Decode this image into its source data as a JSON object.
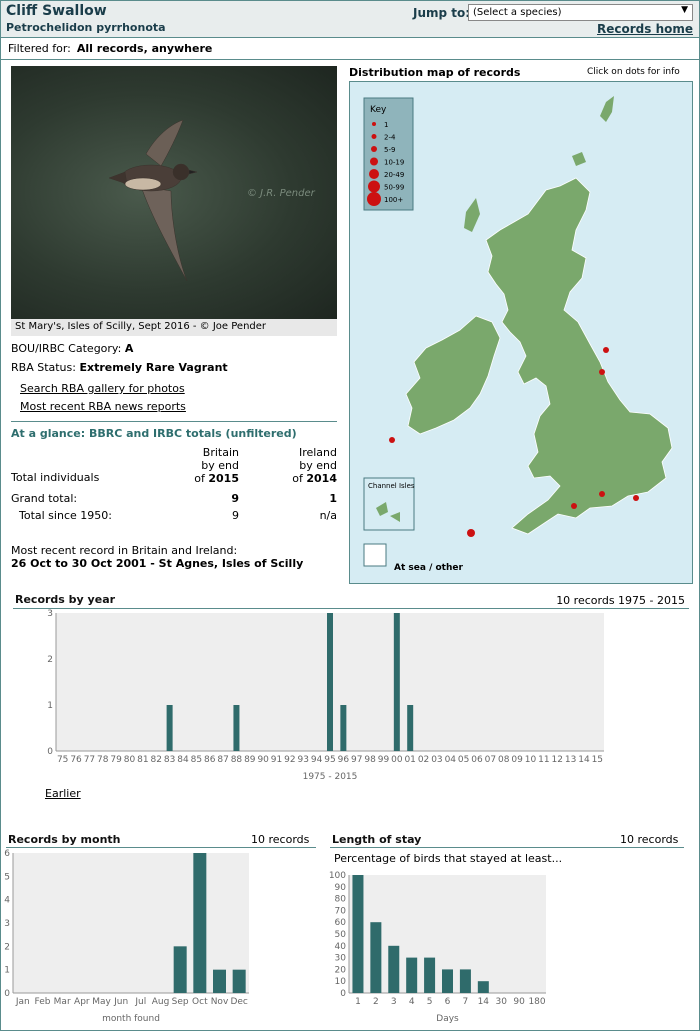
{
  "header": {
    "common_name": "Cliff Swallow",
    "scientific_name": "Petrochelidon pyrrhonota",
    "jump_label": "Jump to:",
    "species_select": "(Select a species)",
    "records_home": "Records home"
  },
  "filter": {
    "label": "Filtered for:",
    "value": "All records, anywhere"
  },
  "photo": {
    "caption": "St Mary's, Isles of Scilly, Sept 2016 - © Joe Pender",
    "watermark": "© J.R. Pender"
  },
  "info": {
    "category_label": "BOU/IRBC Category:",
    "category_value": "A",
    "status_label": "RBA Status:",
    "status_value": "Extremely Rare Vagrant",
    "gallery_link": "Search RBA gallery for photos",
    "news_link": "Most recent RBA news reports"
  },
  "glance": {
    "title": "At a glance: BBRC and IRBC totals (unfiltered)",
    "col1": [
      "Britain",
      "by end",
      "of",
      "2015"
    ],
    "col2": [
      "Ireland",
      "by end",
      "of",
      "2014"
    ],
    "total_individuals": "Total individuals",
    "grand_total_label": "Grand total:",
    "grand_total_britain": "9",
    "grand_total_ireland": "1",
    "since_label": "Total since 1950:",
    "since_britain": "9",
    "since_ireland": "n/a",
    "recent_label": "Most recent record in Britain and Ireland:",
    "recent_value": "26 Oct to 30 Oct 2001 - St Agnes, Isles of Scilly"
  },
  "map": {
    "title": "Distribution map of records",
    "hint": "Click on dots for info",
    "key_title": "Key",
    "key_items": [
      "1",
      "2-4",
      "5-9",
      "10-19",
      "20-49",
      "50-99",
      "100+"
    ],
    "channel_isles": "Channel Isles",
    "at_sea": "At sea / other",
    "land_color": "#7aa86c",
    "sea_color": "#d6ecf3",
    "dot_color": "#cc1111"
  },
  "chart_data": [
    {
      "type": "bar",
      "title": "Records by year",
      "summary": "10 records 1975 - 2015",
      "categories": [
        "75",
        "76",
        "77",
        "78",
        "79",
        "80",
        "81",
        "82",
        "83",
        "84",
        "85",
        "86",
        "87",
        "88",
        "89",
        "90",
        "91",
        "92",
        "93",
        "94",
        "95",
        "96",
        "97",
        "98",
        "99",
        "00",
        "01",
        "02",
        "03",
        "04",
        "05",
        "06",
        "07",
        "08",
        "09",
        "10",
        "11",
        "12",
        "13",
        "14",
        "15"
      ],
      "values": [
        0,
        0,
        0,
        0,
        0,
        0,
        0,
        0,
        1,
        0,
        0,
        0,
        0,
        1,
        0,
        0,
        0,
        0,
        0,
        0,
        3,
        1,
        0,
        0,
        0,
        3,
        1,
        0,
        0,
        0,
        0,
        0,
        0,
        0,
        0,
        0,
        0,
        0,
        0,
        0,
        0
      ],
      "xlabel": "1975 - 2015",
      "ylim": [
        0,
        3
      ],
      "earlier_link": "Earlier"
    },
    {
      "type": "bar",
      "title": "Records by month",
      "summary": "10 records",
      "categories": [
        "Jan",
        "Feb",
        "Mar",
        "Apr",
        "May",
        "Jun",
        "Jul",
        "Aug",
        "Sep",
        "Oct",
        "Nov",
        "Dec"
      ],
      "values": [
        0,
        0,
        0,
        0,
        0,
        0,
        0,
        0,
        2,
        6,
        1,
        1
      ],
      "xlabel": "month found",
      "ylim": [
        0,
        6
      ]
    },
    {
      "type": "bar",
      "title": "Length of stay",
      "summary": "10 records",
      "subtitle": "Percentage of birds that stayed at least...",
      "categories": [
        "1",
        "2",
        "3",
        "4",
        "5",
        "6",
        "7",
        "14",
        "30",
        "90",
        "180"
      ],
      "values": [
        100,
        60,
        40,
        30,
        30,
        20,
        20,
        10,
        0,
        0,
        0
      ],
      "xlabel": "Days",
      "ylim": [
        0,
        100
      ]
    }
  ]
}
